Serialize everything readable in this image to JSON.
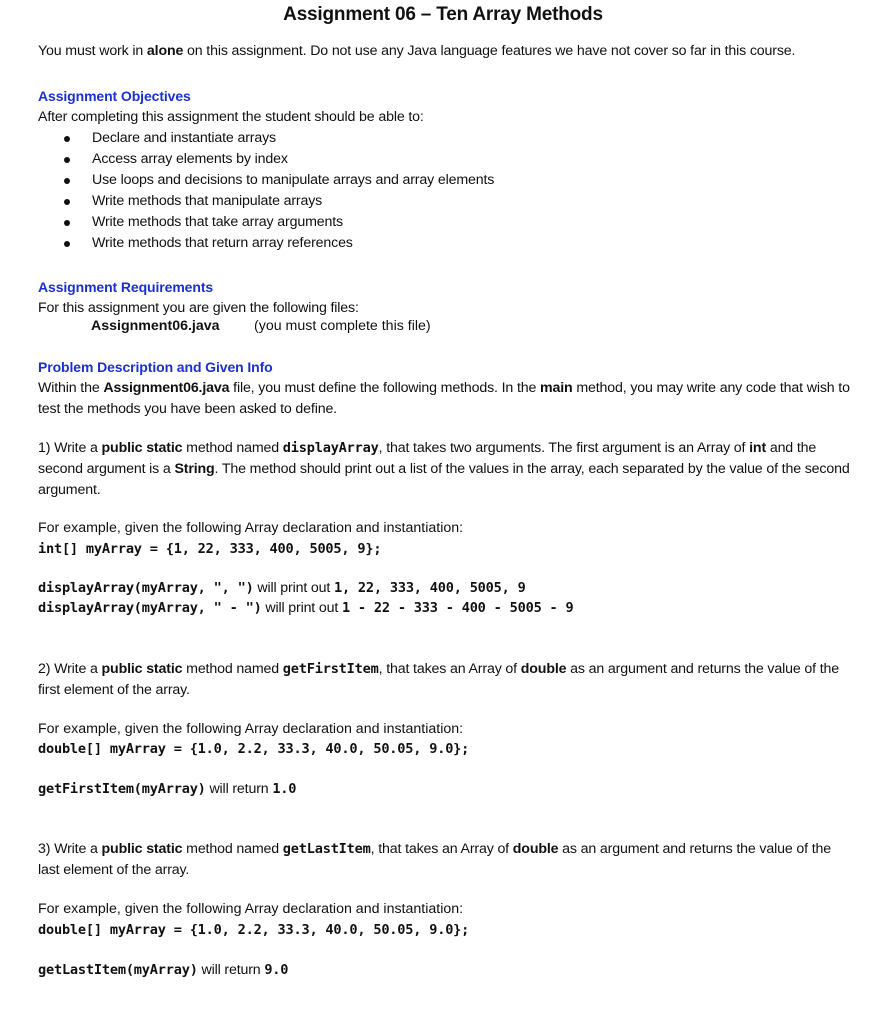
{
  "document": {
    "title": "Assignment 06 – Ten Array Methods",
    "intro": {
      "before": "You must work in ",
      "bold": "alone",
      "after": " on this assignment. Do not use any Java language features we have not cover so far in this course."
    },
    "objectives": {
      "heading": "Assignment Objectives",
      "lead": "After completing this assignment the student should be able to:",
      "items": [
        "Declare and instantiate arrays",
        "Access array elements by index",
        "Use loops and decisions to manipulate arrays and array elements",
        "Write methods that manipulate arrays",
        "Write methods that take array arguments",
        "Write methods that return array references"
      ]
    },
    "requirements": {
      "heading": "Assignment Requirements",
      "lead": "For this assignment you are given the following files:",
      "file_name": "Assignment06.java",
      "file_note": "(you must complete this file)"
    },
    "problem": {
      "heading": "Problem Description and Given Info",
      "p1_before": "Within the ",
      "p1_file": "Assignment06.java",
      "p1_mid": " file, you must define the following methods. In the ",
      "p1_main": "main",
      "p1_after": " method, you may write any code that wish to test the methods you have been asked to define."
    },
    "methods": [
      {
        "number": "1) Write a ",
        "modifier": "public static",
        "named": " method named ",
        "name": "displayArray",
        "desc_a": ", that takes two arguments. The first argument is an Array of ",
        "type1": "int",
        "desc_b": " and the second argument is a ",
        "type2": "String",
        "desc_c": ". The method should print out a list of the values in the array, each separated by the value of the second argument.",
        "example_lead": "For example, given the following Array declaration and instantiation:",
        "declaration": "int[] myArray = {1, 22, 333, 400, 5005, 9};",
        "examples": [
          {
            "call": "displayArray(myArray, \", \")",
            "verb": " will print out ",
            "result": "1, 22, 333, 400, 5005, 9"
          },
          {
            "call": "displayArray(myArray, \" - \")",
            "verb": " will print out ",
            "result": "1 - 22 - 333 - 400 - 5005 - 9"
          }
        ]
      },
      {
        "number": "2) Write a ",
        "modifier": "public static",
        "named": " method named ",
        "name": "getFirstItem",
        "desc_a": ", that takes an Array of ",
        "type1": "double",
        "desc_b": " as an argument and returns the value of the first element of the array.",
        "example_lead": "For example, given the following Array declaration and instantiation:",
        "declaration": "double[] myArray = {1.0, 2.2, 33.3, 40.0, 50.05, 9.0};",
        "examples": [
          {
            "call": "getFirstItem(myArray)",
            "verb": " will return ",
            "result": "1.0"
          }
        ]
      },
      {
        "number": "3) Write a ",
        "modifier": "public static",
        "named": " method named ",
        "name": "getLastItem",
        "desc_a": ", that takes an Array of ",
        "type1": "double",
        "desc_b": " as an argument and returns the value of the last element of the array.",
        "example_lead": "For example, given the following Array declaration and instantiation:",
        "declaration": "double[] myArray = {1.0, 2.2, 33.3, 40.0, 50.05, 9.0};",
        "examples": [
          {
            "call": "getLastItem(myArray)",
            "verb": " will return ",
            "result": "9.0"
          }
        ]
      }
    ]
  },
  "colors": {
    "heading": "#1a2fd6",
    "text": "#111111"
  }
}
